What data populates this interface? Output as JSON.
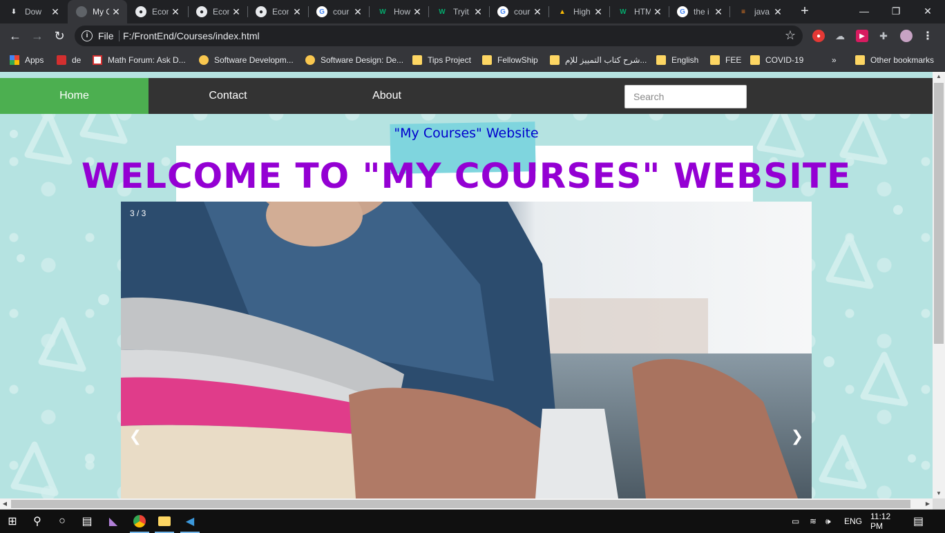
{
  "tabs": [
    {
      "title": "Dow",
      "favicon": "download-icon"
    },
    {
      "title": "My C",
      "favicon": "globe-icon",
      "active": true
    },
    {
      "title": "Econ",
      "favicon": "github-icon"
    },
    {
      "title": "Econ",
      "favicon": "github-icon"
    },
    {
      "title": "Econ",
      "favicon": "github-icon"
    },
    {
      "title": "cour",
      "favicon": "google-icon"
    },
    {
      "title": "How",
      "favicon": "w3schools-icon"
    },
    {
      "title": "Tryit",
      "favicon": "w3schools-icon"
    },
    {
      "title": "cour",
      "favicon": "google-icon"
    },
    {
      "title": "High",
      "favicon": "google-drive-icon"
    },
    {
      "title": "HTM",
      "favicon": "w3schools-icon"
    },
    {
      "title": "the i",
      "favicon": "google-icon"
    },
    {
      "title": "java",
      "favicon": "stackoverflow-icon"
    }
  ],
  "omnibox": {
    "scheme": "File",
    "url": "F:/FrontEnd/Courses/index.html"
  },
  "bookmarks": [
    {
      "label": "Apps",
      "icon": "apps-grid-icon"
    },
    {
      "label": "de",
      "icon": "bookmark-red-icon"
    },
    {
      "label": "Math Forum: Ask D...",
      "icon": "math-forum-icon"
    },
    {
      "label": "Software Developm...",
      "icon": "software-site-icon"
    },
    {
      "label": "Software Design: De...",
      "icon": "software-site-icon"
    },
    {
      "label": "Tips Project",
      "icon": "folder-icon"
    },
    {
      "label": "FellowShip",
      "icon": "folder-icon"
    },
    {
      "label": "شرح كتاب التمييز للإم...",
      "icon": "folder-icon"
    },
    {
      "label": "English",
      "icon": "folder-icon"
    },
    {
      "label": "FEE",
      "icon": "folder-icon"
    },
    {
      "label": "COVID-19",
      "icon": "folder-icon"
    }
  ],
  "other_bookmarks": "Other bookmarks",
  "page": {
    "nav": {
      "home": "Home",
      "contact": "Contact",
      "about": "About"
    },
    "search_placeholder": "Search",
    "tagline": "\"My Courses\" Website",
    "headline": "WELCOME TO \"MY COURSES\" WEBSITE",
    "slideshow": {
      "counter": "3 / 3",
      "prev": "❮",
      "next": "❯",
      "current_slide": 3,
      "total_slides": 3
    }
  },
  "taskbar": {
    "language": "ENG",
    "time": "11:12 PM"
  },
  "colors": {
    "nav_active": "#4caf50",
    "nav_bg": "#333333",
    "page_bg": "#b5e3e1",
    "tagline": "#0000cc",
    "headline": "#9400d3",
    "tape": "#7fd5de"
  }
}
